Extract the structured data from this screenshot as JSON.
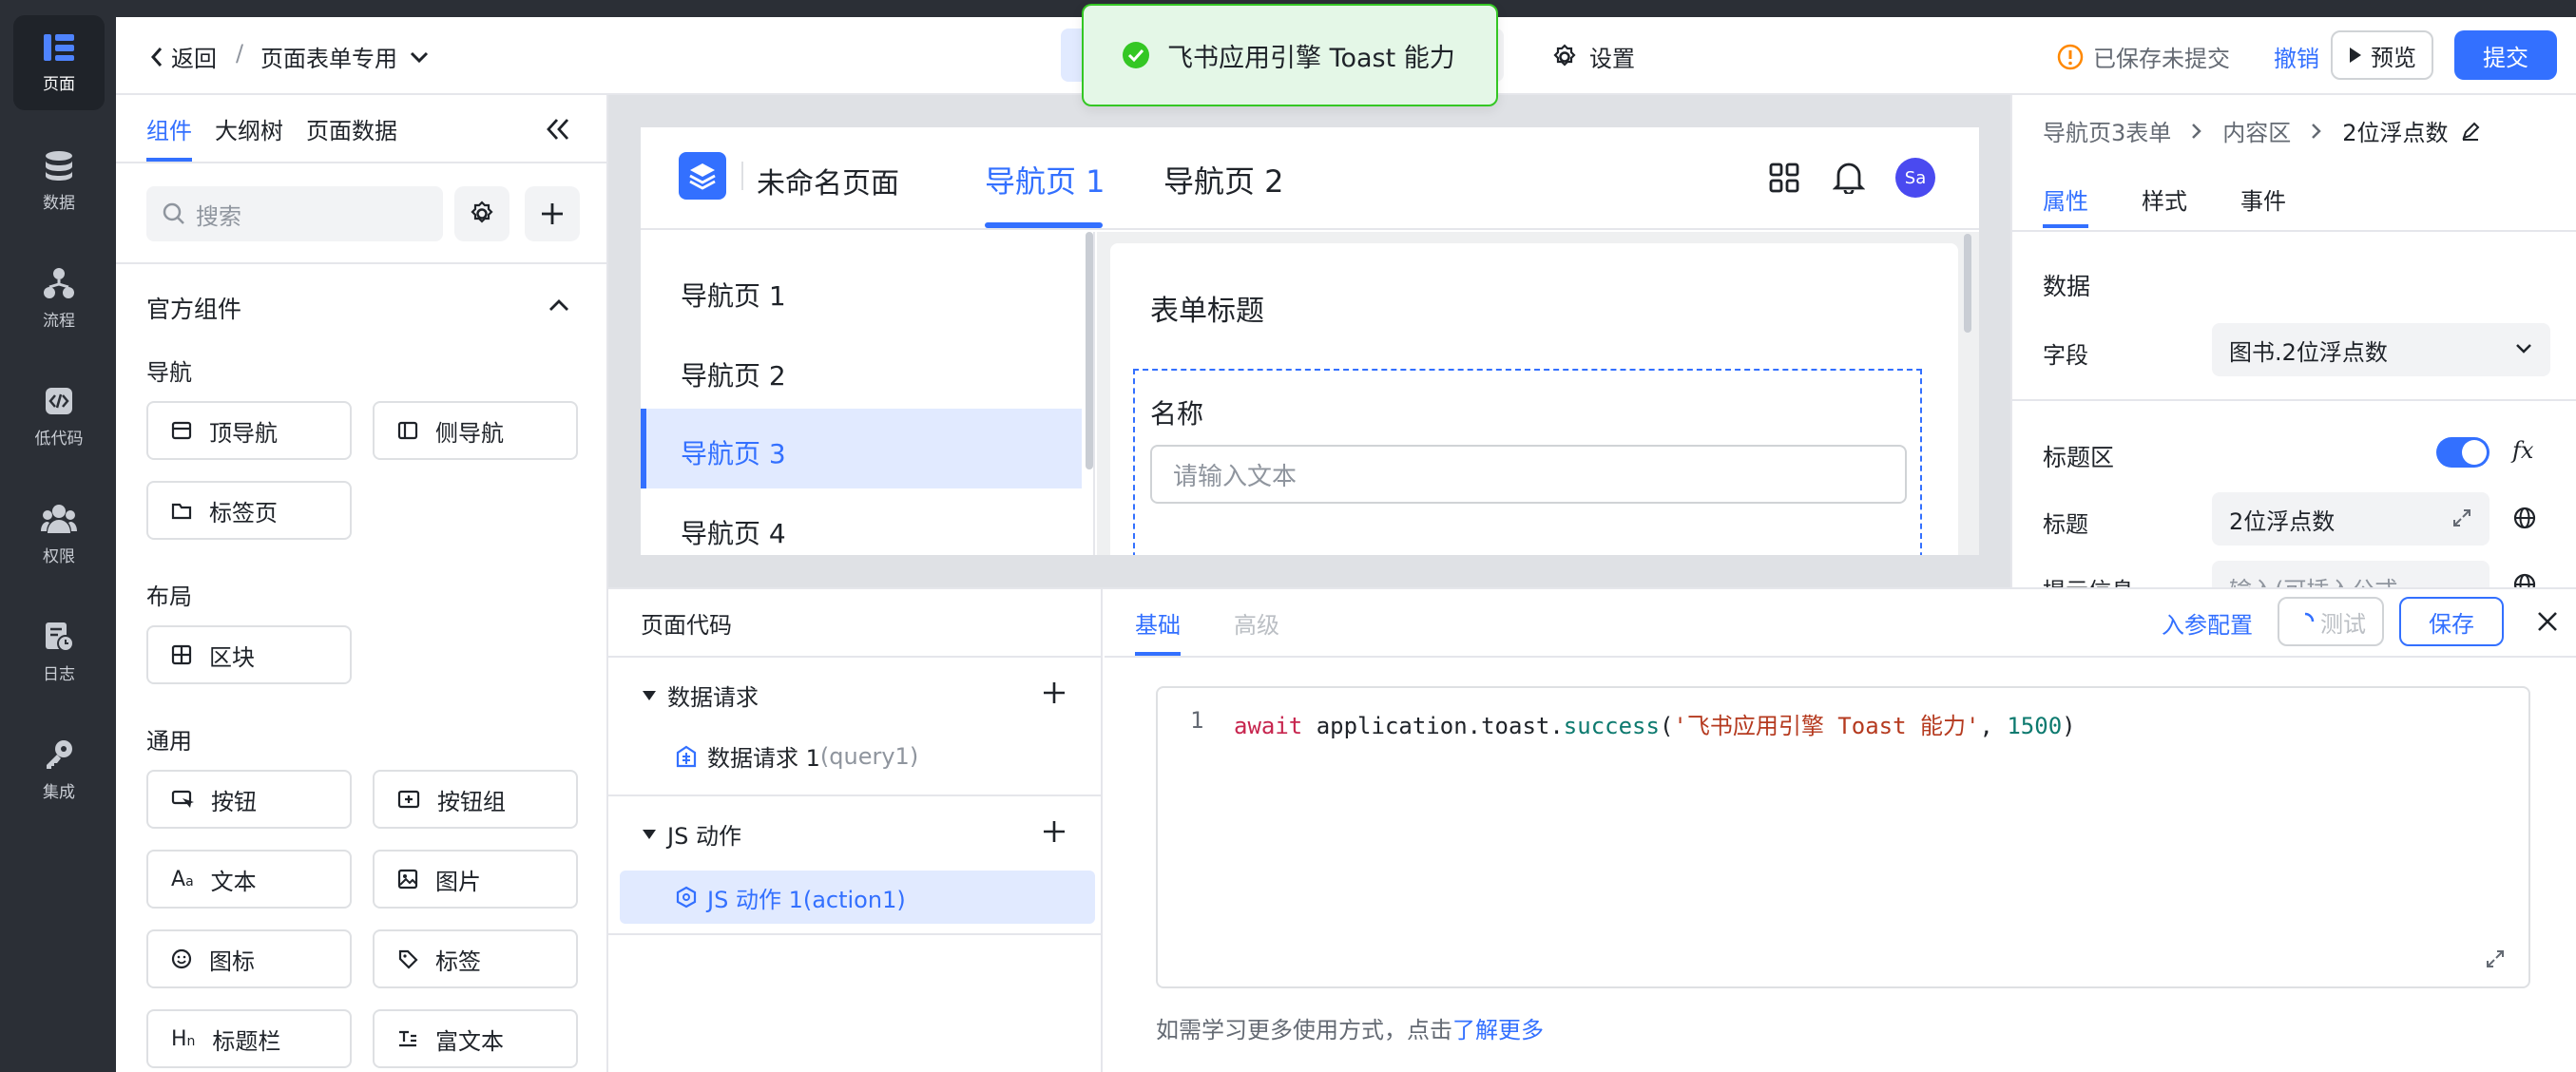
{
  "rail": {
    "items": [
      {
        "label": "页面",
        "icon": "page-icon",
        "active": true
      },
      {
        "label": "数据",
        "icon": "database-icon"
      },
      {
        "label": "流程",
        "icon": "flow-icon"
      },
      {
        "label": "低代码",
        "icon": "code-icon"
      },
      {
        "label": "权限",
        "icon": "users-icon"
      },
      {
        "label": "日志",
        "icon": "log-icon"
      },
      {
        "label": "集成",
        "icon": "key-icon"
      }
    ]
  },
  "header": {
    "back": "返回",
    "separator": "/",
    "page_name": "页面表单专用",
    "settings": "设置",
    "save_status": "已保存未提交",
    "undo": "撤销",
    "preview": "预览",
    "submit": "提交"
  },
  "toast": {
    "message": "飞书应用引擎 Toast 能力"
  },
  "left_panel": {
    "tabs": [
      "组件",
      "大纲树",
      "页面数据"
    ],
    "search_placeholder": "搜索",
    "official_title": "官方组件",
    "groups": {
      "nav": {
        "title": "导航",
        "items": [
          "顶导航",
          "侧导航",
          "标签页"
        ]
      },
      "layout": {
        "title": "布局",
        "items": [
          "区块"
        ]
      },
      "general": {
        "title": "通用",
        "items": [
          "按钮",
          "按钮组",
          "文本",
          "图片",
          "图标",
          "标签",
          "标题栏",
          "富文本"
        ]
      }
    }
  },
  "app": {
    "title": "未命名页面",
    "top_nav": [
      "导航页 1",
      "导航页 2"
    ],
    "avatar": "Sa",
    "side_nav": [
      "导航页 1",
      "导航页 2",
      "导航页 3",
      "导航页 4"
    ],
    "form_title": "表单标题",
    "field_label": "名称",
    "field_placeholder": "请输入文本"
  },
  "right_panel": {
    "breadcrumb": [
      "导航页3表单",
      "内容区",
      "2位浮点数"
    ],
    "tabs": [
      "属性",
      "样式",
      "事件"
    ],
    "data_section": "数据",
    "field_label": "字段",
    "field_value": "图书.2位浮点数",
    "title_area": "标题区",
    "fx": "fx",
    "title_label": "标题",
    "title_value": "2位浮点数",
    "hint_label": "提示信息",
    "hint_placeholder": "输入(可插入公式"
  },
  "code_panel": {
    "title": "页面代码",
    "data_request_group": "数据请求",
    "data_request_item": "数据请求 1",
    "data_request_id": "(query1)",
    "js_group": "JS 动作",
    "js_item": "JS 动作 1(action1)",
    "tabs": [
      "基础",
      "高级"
    ],
    "params_config": "入参配置",
    "test": "测试",
    "save": "保存",
    "line_number": "1",
    "code": {
      "keyword": "await",
      "object": " application.toast.",
      "method": "success",
      "open": "(",
      "string": "'飞书应用引擎 Toast 能力'",
      "comma": ", ",
      "number": "1500",
      "close": ")"
    },
    "help_text": "如需学习更多使用方式，点击",
    "help_link": "了解更多"
  },
  "colors": {
    "accent": "#3370ff",
    "rail_bg": "#2b2f36",
    "toast_bg": "#e4f7e7",
    "success": "#34c724",
    "warning": "#ff8800"
  }
}
